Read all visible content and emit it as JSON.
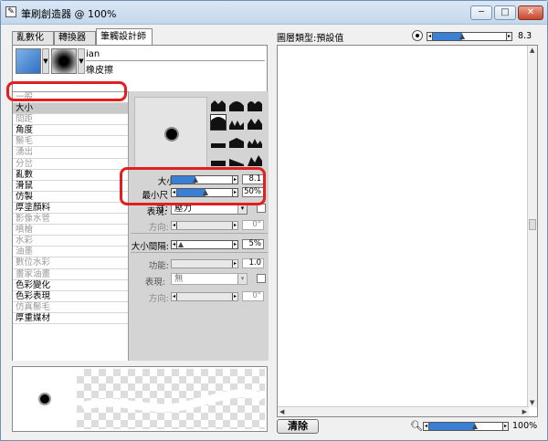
{
  "window": {
    "title": "筆刷創造器 @ 100%",
    "icon": "brush-app-icon"
  },
  "titlebar_buttons": [
    "─",
    "□",
    "✕"
  ],
  "tabs": [
    {
      "label": "亂數化",
      "active": false
    },
    {
      "label": "轉換器",
      "active": false
    },
    {
      "label": "筆觸設計師",
      "active": true
    }
  ],
  "brush": {
    "name": "ian",
    "variant": "橡皮擦"
  },
  "categories": [
    {
      "label": "一般",
      "dim": true
    },
    {
      "label": "大小",
      "selected": true
    },
    {
      "label": "間距",
      "dim": true
    },
    {
      "label": "角度"
    },
    {
      "label": "鬃毛",
      "dim": true
    },
    {
      "label": "湧出",
      "dim": true
    },
    {
      "label": "分岔",
      "dim": true
    },
    {
      "label": "亂數"
    },
    {
      "label": "滑鼠"
    },
    {
      "label": "仿製"
    },
    {
      "label": "厚塗顏料"
    },
    {
      "label": "影像水管",
      "dim": true
    },
    {
      "label": "噴槍",
      "dim": true
    },
    {
      "label": "水彩",
      "dim": true
    },
    {
      "label": "油墨",
      "dim": true
    },
    {
      "label": "數位水彩",
      "dim": true
    },
    {
      "label": "畫家油畫",
      "dim": true
    },
    {
      "label": "色彩變化"
    },
    {
      "label": "色彩表現"
    },
    {
      "label": "仿真鬃毛",
      "dim": true
    },
    {
      "label": "厚重媒材"
    }
  ],
  "size": {
    "label": "大小:",
    "value": "8.1",
    "level": 0.35
  },
  "min_size": {
    "label": "最小尺寸:",
    "value": "50%",
    "level": 0.5
  },
  "expression1": {
    "label": "表現:",
    "value": "壓力"
  },
  "direction1": {
    "label": "方向:",
    "value": "0°"
  },
  "size_step": {
    "label": "大小間隔:",
    "value": "5%",
    "level": 0.05
  },
  "power": {
    "label": "功能:",
    "value": "1.0"
  },
  "expression2": {
    "label": "表現:",
    "value": "無"
  },
  "direction2": {
    "label": "方向:",
    "value": "0°"
  },
  "right": {
    "title": "圖層類型:預設值",
    "top_value": "8.3",
    "top_level": 0.4,
    "zoom": "100%",
    "zoom_level": 0.6,
    "clear_label": "清除"
  },
  "colors": {
    "accent": "#3a7fd6",
    "highlight": "#e02020"
  }
}
